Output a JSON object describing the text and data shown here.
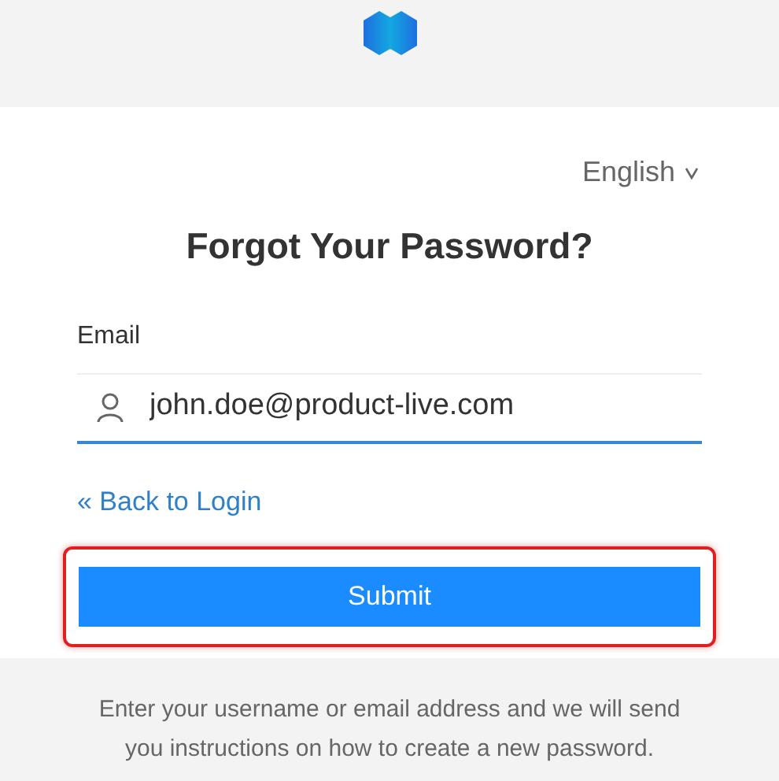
{
  "language": {
    "label": "English"
  },
  "title": "Forgot Your Password?",
  "email": {
    "label": "Email",
    "value": "john.doe@product-live.com"
  },
  "back_link": "« Back to Login",
  "submit": {
    "label": "Submit",
    "highlighted": true
  },
  "footer_text": "Enter your username or email address and we will send you instructions on how to create a new password."
}
